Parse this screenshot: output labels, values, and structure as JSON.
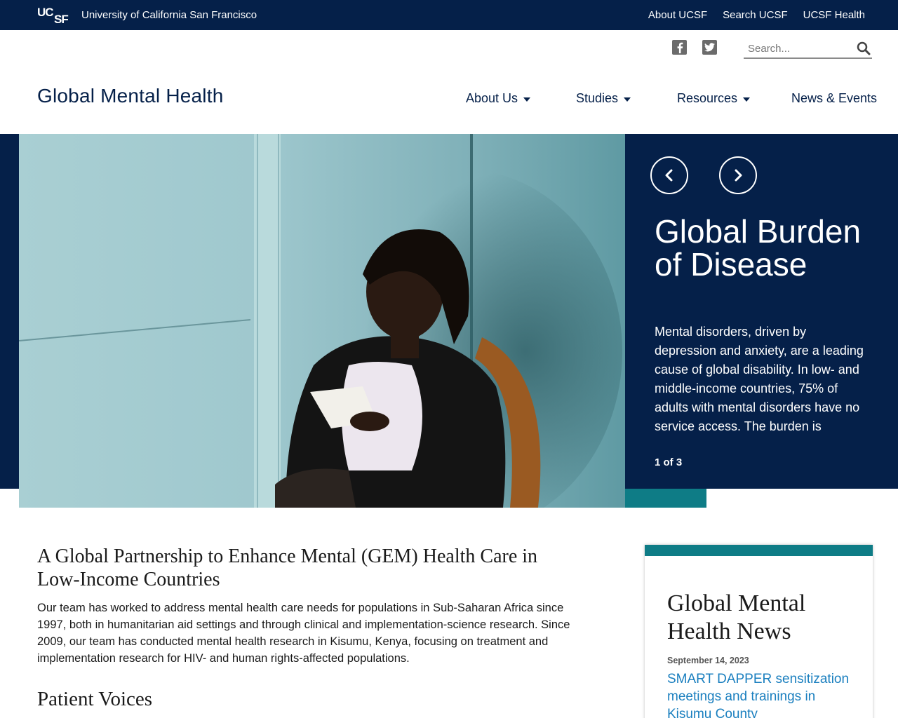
{
  "topbar": {
    "logo_text": "UCSF",
    "university_name": "University of California San Francisco",
    "links": [
      {
        "label": "About UCSF"
      },
      {
        "label": "Search UCSF"
      },
      {
        "label": "UCSF Health"
      }
    ]
  },
  "utility": {
    "social_icons": [
      "facebook-icon",
      "twitter-icon"
    ],
    "search": {
      "placeholder": "Search...",
      "value": ""
    }
  },
  "header": {
    "site_title": "Global Mental Health",
    "nav": [
      {
        "label": "About Us",
        "has_dropdown": true
      },
      {
        "label": "Studies",
        "has_dropdown": true
      },
      {
        "label": "Resources",
        "has_dropdown": true
      },
      {
        "label": "News & Events",
        "has_dropdown": false
      }
    ]
  },
  "hero": {
    "slide_title": "Global Burden of Disease",
    "slide_text": "Mental disorders, driven by depression and anxiety, are a leading cause of global disability. In low- and middle-income countries, 75% of adults with mental disorders have no service access. The burden is greater...",
    "slide_counter": "1 of 3",
    "colors": {
      "panel": "#052049",
      "accent": "#0e7c86"
    }
  },
  "main": {
    "heading": "A Global Partnership to Enhance Mental (GEM) Health Care in Low-Income Countries",
    "paragraph": "Our team has worked to address mental health care needs for populations in Sub-Saharan Africa since 1997, both in humanitarian aid settings and through clinical and implementation-science research. Since 2009, our team has conducted mental health research in Kisumu, Kenya, focusing on treatment and implementation research for HIV- and human rights-affected populations.",
    "subheading": "Patient Voices"
  },
  "news": {
    "heading": "Global Mental Health News",
    "items": [
      {
        "date": "September 14, 2023",
        "title": "SMART DAPPER sensitization meetings and trainings in Kisumu County"
      }
    ]
  }
}
